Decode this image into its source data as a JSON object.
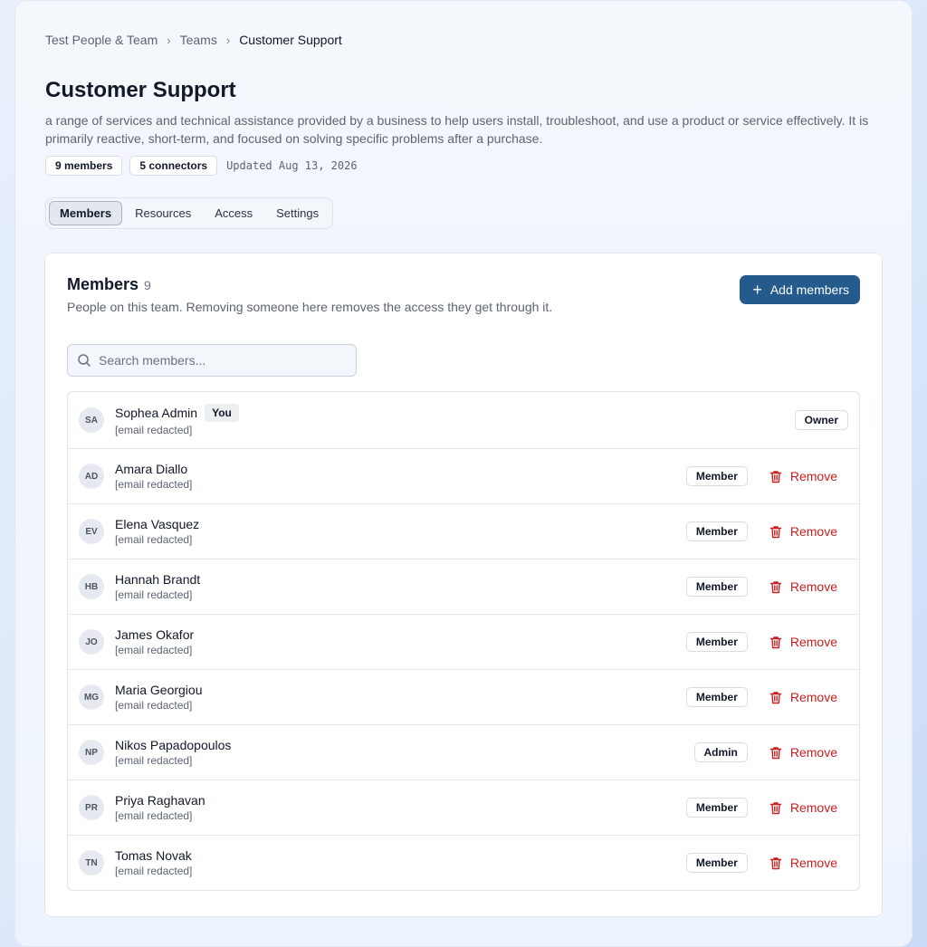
{
  "breadcrumb": {
    "items": [
      "Test People & Team",
      "Teams"
    ],
    "current": "Customer Support"
  },
  "page": {
    "title": "Customer Support",
    "description": "a range of services and technical assistance provided by a business to help users install, troubleshoot, and use a product or service effectively. It is primarily reactive, short-term, and focused on solving specific problems after a purchase.",
    "members_chip": "9 members",
    "connectors_chip": "5 connectors",
    "updated": "Updated Aug 13, 2026"
  },
  "tabs": [
    {
      "label": "Members",
      "active": true
    },
    {
      "label": "Resources",
      "active": false
    },
    {
      "label": "Access",
      "active": false
    },
    {
      "label": "Settings",
      "active": false
    }
  ],
  "members_card": {
    "title": "Members",
    "count": "9",
    "subtitle": "People on this team. Removing someone here removes the access they get through it.",
    "add_button": "Add members",
    "search_placeholder": "Search members...",
    "remove_label": "Remove",
    "you_label": "You"
  },
  "members": [
    {
      "initials": "SA",
      "name": "Sophea Admin",
      "email": "[email redacted]",
      "role": "Owner",
      "is_you": true
    },
    {
      "initials": "AD",
      "name": "Amara Diallo",
      "email": "[email redacted]",
      "role": "Member",
      "is_you": false
    },
    {
      "initials": "EV",
      "name": "Elena Vasquez",
      "email": "[email redacted]",
      "role": "Member",
      "is_you": false
    },
    {
      "initials": "HB",
      "name": "Hannah Brandt",
      "email": "[email redacted]",
      "role": "Member",
      "is_you": false
    },
    {
      "initials": "JO",
      "name": "James Okafor",
      "email": "[email redacted]",
      "role": "Member",
      "is_you": false
    },
    {
      "initials": "MG",
      "name": "Maria Georgiou",
      "email": "[email redacted]",
      "role": "Member",
      "is_you": false
    },
    {
      "initials": "NP",
      "name": "Nikos Papadopoulos",
      "email": "[email redacted]",
      "role": "Admin",
      "is_you": false
    },
    {
      "initials": "PR",
      "name": "Priya Raghavan",
      "email": "[email redacted]",
      "role": "Member",
      "is_you": false
    },
    {
      "initials": "TN",
      "name": "Tomas Novak",
      "email": "[email redacted]",
      "role": "Member",
      "is_you": false
    }
  ],
  "colors": {
    "accent": "#245a8c",
    "danger": "#c81e1e"
  }
}
